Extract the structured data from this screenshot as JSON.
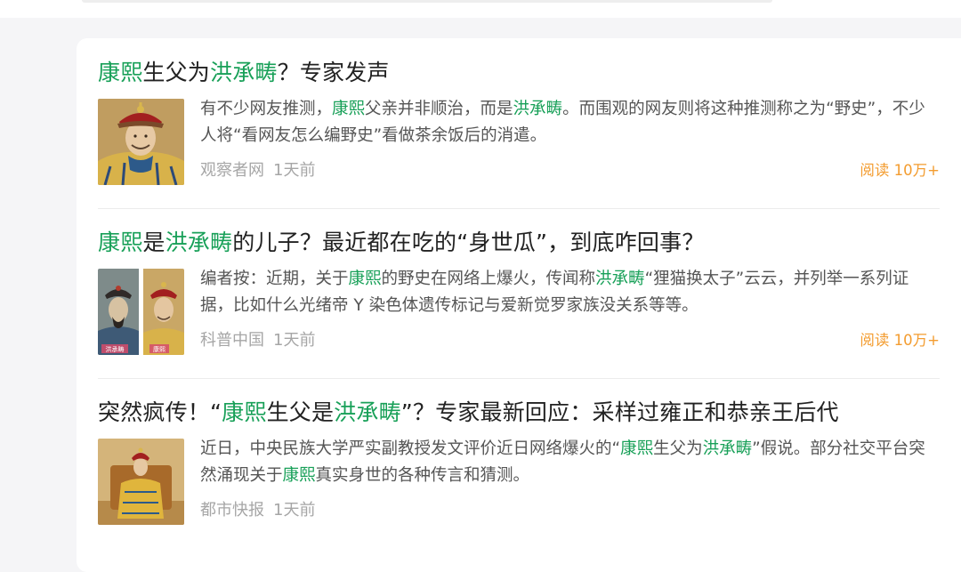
{
  "results": [
    {
      "title": [
        {
          "t": "康熙",
          "hl": true
        },
        {
          "t": "生父为",
          "hl": false
        },
        {
          "t": "洪承畴",
          "hl": true
        },
        {
          "t": "？专家发声",
          "hl": false
        }
      ],
      "summary": [
        {
          "t": "有不少网友推测，",
          "hl": false
        },
        {
          "t": "康熙",
          "hl": true
        },
        {
          "t": "父亲并非顺治，而是",
          "hl": false
        },
        {
          "t": "洪承畴",
          "hl": true
        },
        {
          "t": "。而围观的网友则将这种推测称之为“野史”，不少人将“看网友怎么编野史”看做茶余饭后的消遣。",
          "hl": false
        }
      ],
      "source": "观察者网",
      "time": "1天前",
      "reads": "阅读 10万+"
    },
    {
      "title": [
        {
          "t": "康熙",
          "hl": true
        },
        {
          "t": "是",
          "hl": false
        },
        {
          "t": "洪承畴",
          "hl": true
        },
        {
          "t": "的儿子？最近都在吃的“身世瓜”，到底咋回事？",
          "hl": false
        }
      ],
      "summary": [
        {
          "t": "编者按：近期，关于",
          "hl": false
        },
        {
          "t": "康熙",
          "hl": true
        },
        {
          "t": "的野史在网络上爆火，传闻称",
          "hl": false
        },
        {
          "t": "洪承畴",
          "hl": true
        },
        {
          "t": "“狸猫换太子”云云，并列举一系列证据，比如什么光绪帝 Y 染色体遗传标记与爱新觉罗家族没关系等等。",
          "hl": false
        }
      ],
      "thumb_captions": [
        "洪承畴",
        "康熙"
      ],
      "source": "科普中国",
      "time": "1天前",
      "reads": "阅读 10万+"
    },
    {
      "title": [
        {
          "t": "突然疯传！“",
          "hl": false
        },
        {
          "t": "康熙",
          "hl": true
        },
        {
          "t": "生父是",
          "hl": false
        },
        {
          "t": "洪承畴",
          "hl": true
        },
        {
          "t": "”？专家最新回应：采样过雍正和恭亲王后代",
          "hl": false
        }
      ],
      "summary": [
        {
          "t": "近日，中央民族大学严实副教授发文评价近日网络爆火的“",
          "hl": false
        },
        {
          "t": "康熙",
          "hl": true
        },
        {
          "t": "生父为",
          "hl": false
        },
        {
          "t": "洪承畴",
          "hl": true
        },
        {
          "t": "”假说。部分社交平台突然涌现关于",
          "hl": false
        },
        {
          "t": "康熙",
          "hl": true
        },
        {
          "t": "真实身世的各种传言和猜测。",
          "hl": false
        }
      ],
      "source": "都市快报",
      "time": "1天前"
    }
  ],
  "colors": {
    "highlight": "#18a058",
    "reads": "#f39c2f",
    "meta": "#a6a6a6",
    "title": "#222222",
    "summary": "#555555"
  }
}
